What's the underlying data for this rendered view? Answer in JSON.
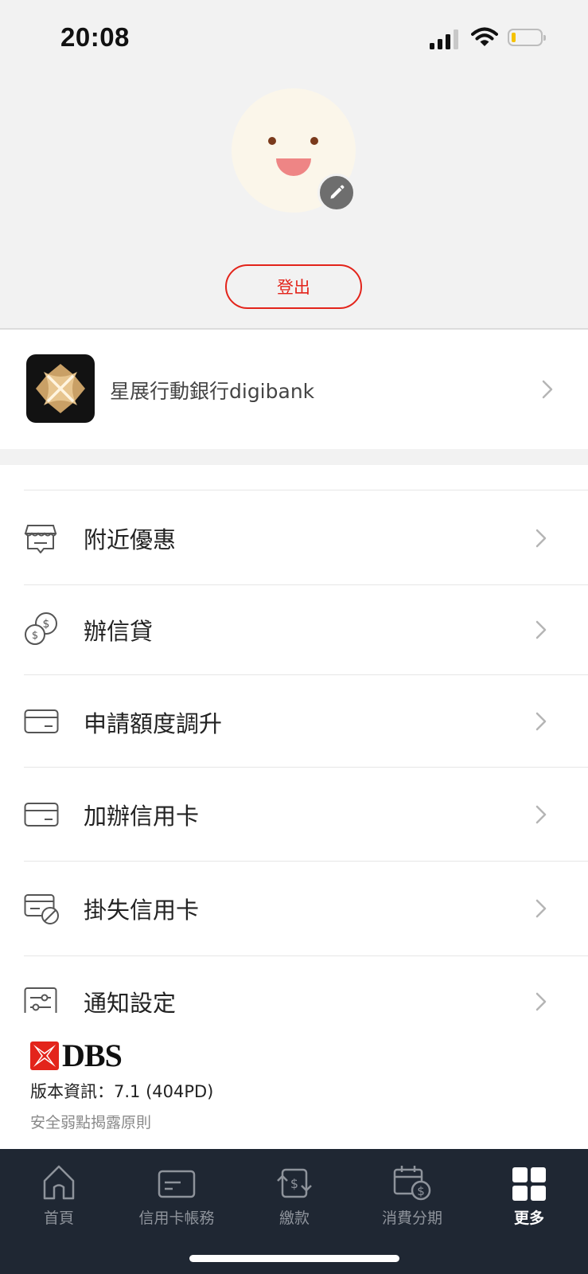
{
  "status_bar": {
    "time": "20:08"
  },
  "profile": {
    "logout_label": "登出"
  },
  "digibank": {
    "label": "星展行動銀行digibank"
  },
  "menu": {
    "items": [
      {
        "label": "附近優惠",
        "icon": "store-icon"
      },
      {
        "label": "辦信貸",
        "icon": "coins-icon"
      },
      {
        "label": "申請額度調升",
        "icon": "card-icon"
      },
      {
        "label": "加辦信用卡",
        "icon": "card-icon"
      },
      {
        "label": "掛失信用卡",
        "icon": "card-block-icon"
      },
      {
        "label": "通知設定",
        "icon": "sliders-icon"
      }
    ]
  },
  "footer": {
    "brand": "DBS",
    "version": "版本資訊：7.1 (404PD)",
    "policy_link": "安全弱點揭露原則"
  },
  "tabbar": {
    "tabs": [
      {
        "label": "首頁",
        "icon": "home-icon"
      },
      {
        "label": "信用卡帳務",
        "icon": "card-icon"
      },
      {
        "label": "繳款",
        "icon": "payment-icon"
      },
      {
        "label": "消費分期",
        "icon": "calendar-dollar-icon"
      },
      {
        "label": "更多",
        "icon": "grid-icon",
        "active": true
      }
    ]
  },
  "colors": {
    "accent": "#e3241b",
    "tabbar_bg": "#1f2733",
    "header_bg": "#f2f2f2"
  }
}
